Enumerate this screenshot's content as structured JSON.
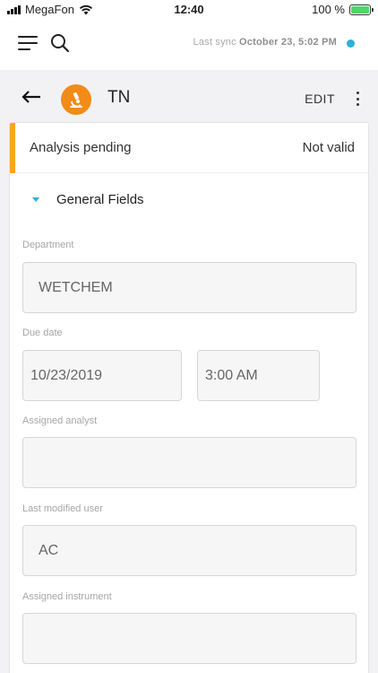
{
  "status_bar": {
    "carrier": "MegaFon",
    "time": "12:40",
    "battery": "100 %",
    "battery_level": 100
  },
  "top_bar": {
    "sync_prefix": "Last sync",
    "sync_date": "October 23, 5:02 PM",
    "sync_dot_color": "#2bb0d8"
  },
  "header": {
    "title": "TN",
    "edit_label": "EDIT",
    "avatar_color": "#f28b17"
  },
  "card": {
    "status_label": "Analysis pending",
    "status_value": "Not valid",
    "accent_color": "#f5a623",
    "section_title": "General Fields",
    "fields": {
      "department": {
        "label": "Department",
        "value": "WETCHEM"
      },
      "due_date": {
        "label": "Due date",
        "date": "10/23/2019",
        "time": "3:00 AM"
      },
      "assigned_analyst": {
        "label": "Assigned analyst",
        "value": ""
      },
      "last_modified_user": {
        "label": "Last modified user",
        "value": "AC"
      },
      "assigned_instrument": {
        "label": "Assigned instrument",
        "value": ""
      }
    }
  },
  "icons": [
    "menu-icon",
    "search-icon",
    "back-arrow-icon",
    "microscope-icon",
    "more-vertical-icon",
    "caret-down-icon",
    "wifi-icon",
    "battery-icon",
    "signal-icon"
  ]
}
